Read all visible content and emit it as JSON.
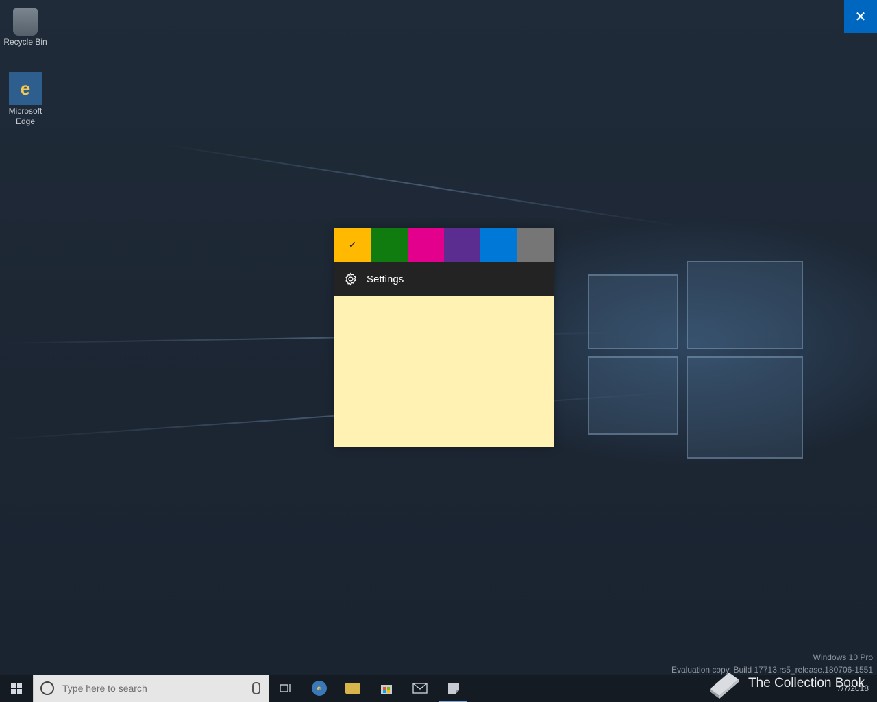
{
  "desktop": {
    "icons": [
      {
        "label": "Recycle Bin"
      },
      {
        "label": "Microsoft Edge"
      }
    ]
  },
  "colors": {
    "swatches": [
      "#ffb900",
      "#107c10",
      "#e3008c",
      "#5c2d91",
      "#0078d7",
      "#767676"
    ],
    "note": "#fff2b3",
    "menu": "#232323",
    "close": "#0067c0"
  },
  "note": {
    "selected_mark": "✓",
    "menu": {
      "settings_label": "Settings"
    }
  },
  "close": {
    "glyph": "✕"
  },
  "taskbar": {
    "search_placeholder": "Type here to search",
    "date": "7/7/2018"
  },
  "watermark": {
    "line1": "Windows 10 Pro",
    "line2": "Evaluation copy. Build 17713.rs5_release.180706-1551"
  },
  "overlay": {
    "text": "The Collection Book"
  }
}
